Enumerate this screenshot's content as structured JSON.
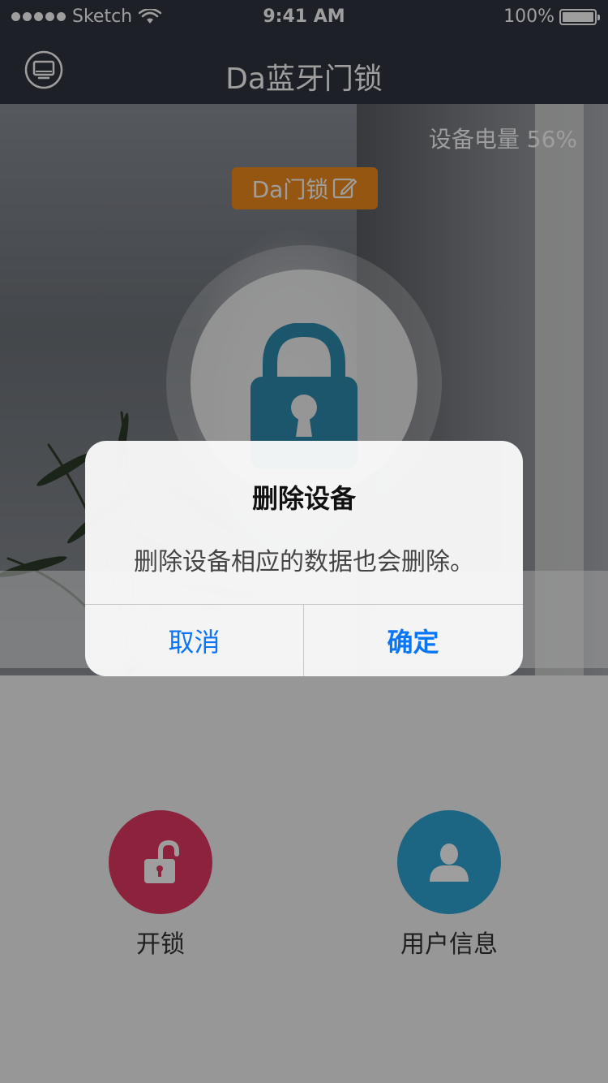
{
  "status_bar": {
    "carrier": "Sketch",
    "time": "9:41 AM",
    "battery_percent": "100%",
    "icons": [
      "signal-dots-icon",
      "wifi-icon",
      "battery-icon"
    ]
  },
  "navbar": {
    "title": "Da蓝牙门锁",
    "left_icon": "monitor-icon"
  },
  "hero": {
    "battery_label": "设备电量 56%",
    "device_name": "Da门锁",
    "device_name_icon": "edit-icon",
    "center_icon": "lock-icon"
  },
  "actions": [
    {
      "label": "开锁",
      "icon": "unlock-icon",
      "color": "#e2385f"
    },
    {
      "label": "用户信息",
      "icon": "user-icon",
      "color": "#2ea5d3"
    }
  ],
  "alert": {
    "title": "删除设备",
    "message": "删除设备相应的数据也会删除。",
    "cancel_label": "取消",
    "confirm_label": "确定"
  },
  "colors": {
    "nav_bg": "#31343f",
    "accent_orange": "#f08c1e",
    "lock_blue": "#2e8bb0",
    "alert_button_blue": "#0a76f5"
  }
}
